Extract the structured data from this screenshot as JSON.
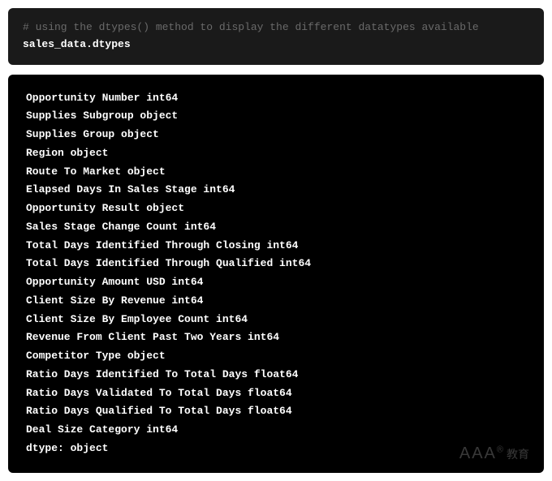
{
  "code": {
    "comment": "# using the dtypes() method to display the different datatypes available",
    "statement": "sales_data.dtypes"
  },
  "output": {
    "lines": [
      "Opportunity Number int64",
      "Supplies Subgroup object",
      "Supplies Group object",
      "Region object",
      "Route To Market object",
      "Elapsed Days In Sales Stage int64",
      "Opportunity Result object",
      "Sales Stage Change Count int64",
      "Total Days Identified Through Closing int64",
      "Total Days Identified Through Qualified int64",
      "Opportunity Amount USD int64",
      "Client Size By Revenue int64",
      "Client Size By Employee Count int64",
      "Revenue From Client Past Two Years int64",
      "Competitor Type object",
      "Ratio Days Identified To Total Days float64",
      "Ratio Days Validated To Total Days float64",
      "Ratio Days Qualified To Total Days float64",
      "Deal Size Category int64",
      "dtype: object"
    ]
  },
  "watermark": {
    "primary": "AAA",
    "sup": "®",
    "secondary": "教育"
  }
}
